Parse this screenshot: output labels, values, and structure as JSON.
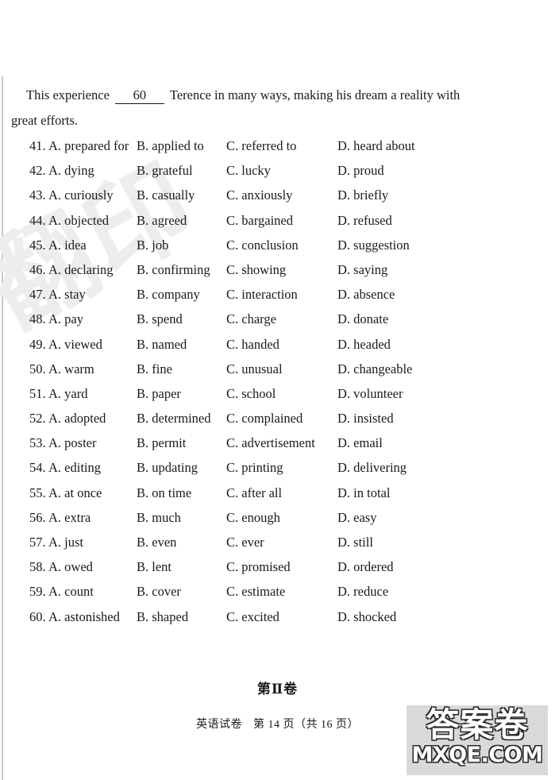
{
  "passage": {
    "line1_before": "This experience",
    "blank_number": "60",
    "line1_after": "Terence in many ways, making his dream a reality with",
    "line2": "great efforts."
  },
  "questions": [
    {
      "num": "41.",
      "a": "A. prepared for",
      "b": "B. applied to",
      "c": "C. referred to",
      "d": "D. heard about"
    },
    {
      "num": "42.",
      "a": "A. dying",
      "b": "B. grateful",
      "c": "C. lucky",
      "d": "D. proud"
    },
    {
      "num": "43.",
      "a": "A. curiously",
      "b": "B. casually",
      "c": "C. anxiously",
      "d": "D. briefly"
    },
    {
      "num": "44.",
      "a": "A. objected",
      "b": "B. agreed",
      "c": "C. bargained",
      "d": "D. refused"
    },
    {
      "num": "45.",
      "a": "A. idea",
      "b": "B. job",
      "c": "C. conclusion",
      "d": "D. suggestion"
    },
    {
      "num": "46.",
      "a": "A. declaring",
      "b": "B. confirming",
      "c": "C. showing",
      "d": "D. saying"
    },
    {
      "num": "47.",
      "a": "A. stay",
      "b": "B. company",
      "c": "C. interaction",
      "d": "D. absence"
    },
    {
      "num": "48.",
      "a": "A. pay",
      "b": "B. spend",
      "c": "C. charge",
      "d": "D. donate"
    },
    {
      "num": "49.",
      "a": "A. viewed",
      "b": "B. named",
      "c": "C. handed",
      "d": "D. headed"
    },
    {
      "num": "50.",
      "a": "A. warm",
      "b": "B. fine",
      "c": "C. unusual",
      "d": "D. changeable"
    },
    {
      "num": "51.",
      "a": "A. yard",
      "b": "B. paper",
      "c": "C. school",
      "d": "D. volunteer"
    },
    {
      "num": "52.",
      "a": "A. adopted",
      "b": "B. determined",
      "c": "C. complained",
      "d": "D. insisted"
    },
    {
      "num": "53.",
      "a": "A. poster",
      "b": "B. permit",
      "c": "C. advertisement",
      "d": "D. email"
    },
    {
      "num": "54.",
      "a": "A. editing",
      "b": "B. updating",
      "c": "C. printing",
      "d": "D. delivering"
    },
    {
      "num": "55.",
      "a": "A. at once",
      "b": "B. on time",
      "c": "C. after all",
      "d": "D. in total"
    },
    {
      "num": "56.",
      "a": "A. extra",
      "b": "B. much",
      "c": "C. enough",
      "d": "D. easy"
    },
    {
      "num": "57.",
      "a": "A. just",
      "b": "B. even",
      "c": "C. ever",
      "d": "D. still"
    },
    {
      "num": "58.",
      "a": "A. owed",
      "b": "B. lent",
      "c": "C. promised",
      "d": "D. ordered"
    },
    {
      "num": "59.",
      "a": "A. count",
      "b": "B. cover",
      "c": "C. estimate",
      "d": "D. reduce"
    },
    {
      "num": "60.",
      "a": "A. astonished",
      "b": "B. shaped",
      "c": "C. excited",
      "d": "D. shocked"
    }
  ],
  "section_heading": "第Ⅱ卷",
  "footer": {
    "subject": "英语试卷",
    "page_label": "第 14 页（共 16 页）"
  },
  "watermarks": {
    "diagonal_text": "翻印",
    "logo_cn": "答案卷",
    "logo_en": "MXQE.COM"
  }
}
